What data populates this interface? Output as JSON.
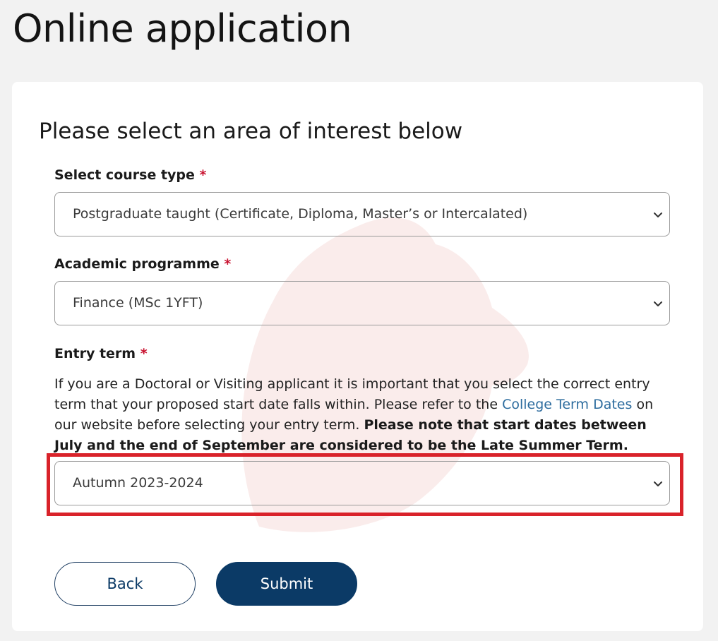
{
  "page": {
    "title": "Online application"
  },
  "form": {
    "heading": "Please select an area of interest below",
    "required_marker": "*",
    "course_type": {
      "label": "Select course type",
      "value": "Postgraduate taught (Certificate, Diploma, Master’s or Intercalated)"
    },
    "programme": {
      "label": "Academic programme",
      "value": "Finance (MSc 1YFT)"
    },
    "entry_term": {
      "label": "Entry term",
      "help_part1": "If you are a Doctoral or Visiting applicant it is important that you select the correct entry term that your proposed start date falls within. Please refer to the ",
      "help_link": "College Term Dates",
      "help_part2": " on our website before selecting your entry term. ",
      "help_bold": "Please note that start dates between July and the end of September are considered to be the Late Summer Term.",
      "value": "Autumn 2023-2024"
    }
  },
  "buttons": {
    "back": "Back",
    "submit": "Submit"
  },
  "colors": {
    "primary": "#0b3a66",
    "required": "#c8102e",
    "link": "#2d6c9e",
    "highlight": "#d9222a",
    "page_bg": "#f2f2f2"
  }
}
